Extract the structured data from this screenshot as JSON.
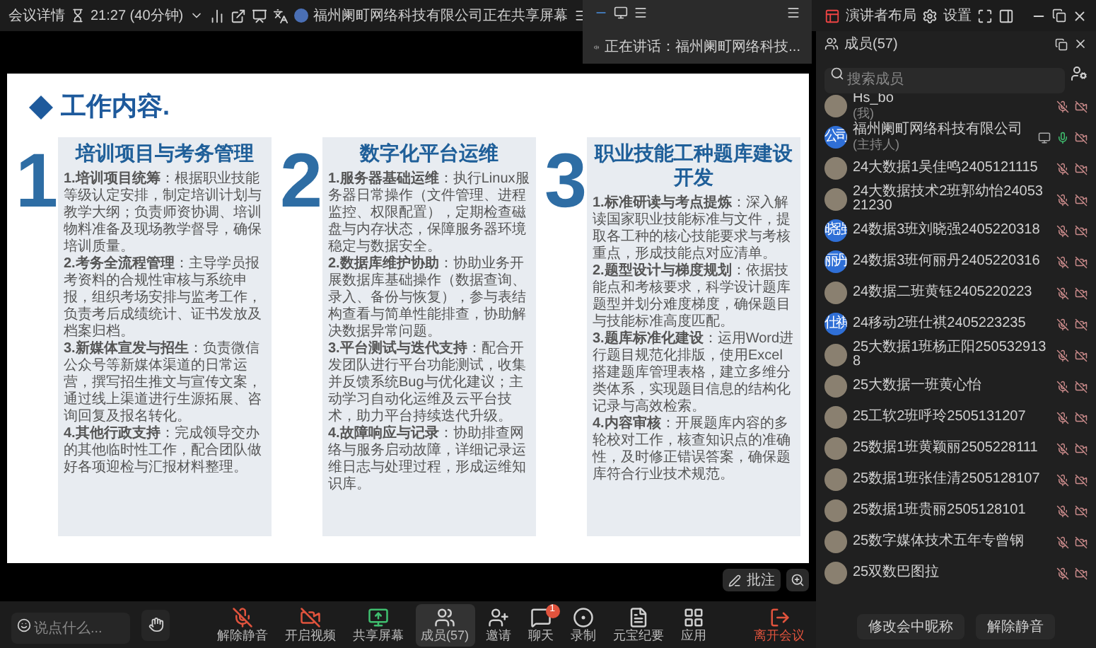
{
  "top_bar": {
    "meeting_info": "会议详情",
    "time": "21:27 (40分钟)",
    "sharing_notice": "福州阑町网络科技有限公司正在共享屏幕",
    "layout": "演讲者布局",
    "settings": "设置"
  },
  "speaker_overlay": {
    "label": "正在讲话：福州阑町网络科技..."
  },
  "slide": {
    "title": "工作内容.",
    "sections": [
      {
        "number": "1",
        "title": "培训项目与考务管理",
        "paragraphs": [
          "**1.培训项目统筹**：根据职业技能等级认定安排，制定培训计划与教学大纲；负责师资协调、培训物料准备及现场教学督导，确保培训质量。",
          "**2.考务全流程管理**：主导学员报考资料的合规性审核与系统申报，组织考场安排与监考工作，负责考后成绩统计、证书发放及档案归档。",
          "**3.新媒体宣发与招生**：负责微信公众号等新媒体渠道的日常运营，撰写招生推文与宣传文案，通过线上渠道进行生源拓展、咨询回复及报名转化。",
          "**4.其他行政支持**：完成领导交办的其他临时性工作，配合团队做好各项迎检与汇报材料整理。"
        ]
      },
      {
        "number": "2",
        "title": "数字化平台运维",
        "paragraphs": [
          "**1.服务器基础运维**：执行Linux服务器日常操作（文件管理、进程监控、权限配置），定期检查磁盘与内存状态，保障服务器环境稳定与数据安全。",
          "**2.数据库维护协助**：协助业务开展数据库基础操作（数据查询、录入、备份与恢复），参与表结构查看与简单性能排查，协助解决数据异常问题。",
          "**3.平台测试与迭代支持**：配合开发团队进行平台功能测试，收集并反馈系统Bug与优化建议；主动学习自动化运维及云平台技术，助力平台持续迭代升级。",
          "**4.故障响应与记录**：协助排查网络与服务启动故障，详细记录运维日志与处理过程，形成运维知识库。"
        ]
      },
      {
        "number": "3",
        "title": "职业技能工种题库建设开发",
        "paragraphs": [
          "**1.标准研读与考点提炼**：深入解读国家职业技能标准与文件，提取各工种的核心技能要求与考核重点，形成技能点对应清单。",
          "**2.题型设计与梯度规划**：依据技能点和考核要求，科学设计题库题型并划分难度梯度，确保题目与技能标准高度匹配。",
          "**3.题库标准化建设**：运用Word进行题目规范化排版，使用Excel搭建题库管理表格，建立多维分类体系，实现题目信息的结构化记录与高效检索。",
          "**4.内容审核**：开展题库内容的多轮校对工作，核查知识点的准确性，及时修正错误答案，确保题库符合行业技术规范。"
        ]
      }
    ]
  },
  "annotate_button": "批注",
  "toolbar": {
    "chat_input": {
      "placeholder": "说点什么..."
    },
    "buttons": [
      {
        "kind": "mic",
        "label": "解除静音",
        "selected": false
      },
      {
        "kind": "camera",
        "label": "开启视频",
        "selected": false
      },
      {
        "kind": "share",
        "label": "共享屏幕",
        "selected": false
      },
      {
        "kind": "members",
        "label": "成员(57)",
        "selected": true
      },
      {
        "kind": "invite",
        "label": "邀请",
        "selected": false
      },
      {
        "kind": "chat",
        "label": "聊天",
        "selected": false,
        "badge": "1"
      },
      {
        "kind": "record",
        "label": "录制",
        "selected": false
      },
      {
        "kind": "minutes",
        "label": "元宝纪要",
        "selected": false
      },
      {
        "kind": "apps",
        "label": "应用",
        "selected": false
      }
    ],
    "leave": "离开会议"
  },
  "members_panel": {
    "title": "成员(57)",
    "search": {
      "placeholder": "搜索成员"
    },
    "members": [
      {
        "name": "Hs_bo",
        "role": "(我)",
        "kind": "photo",
        "muted": true,
        "sharing": false
      },
      {
        "name": "福州阑町网络科技有限公司",
        "role": "(主持人)",
        "kind": "text",
        "avatar_text": "公司",
        "muted": false,
        "sharing": true
      },
      {
        "name": "24大数据1吴佳鸣2405121115",
        "kind": "photo",
        "muted": true,
        "sharing": false
      },
      {
        "name": "24大数据技术2班郭幼怡2405321230",
        "kind": "photo",
        "muted": true,
        "sharing": false
      },
      {
        "name": "24数据3班刘晓强2405220318",
        "kind": "text",
        "avatar_text": "晓强",
        "muted": true,
        "sharing": false
      },
      {
        "name": "24数据3班何丽丹2405220316",
        "kind": "text",
        "avatar_text": "丽丹",
        "muted": true,
        "sharing": false
      },
      {
        "name": "24数据二班黄钰2405220223",
        "kind": "photo",
        "muted": true,
        "sharing": false
      },
      {
        "name": "24移动2班仕祺2405223235",
        "kind": "text",
        "avatar_text": "仕祺",
        "muted": true,
        "sharing": false
      },
      {
        "name": "25大数据1班杨正阳2505329138",
        "kind": "photo",
        "muted": true,
        "sharing": false
      },
      {
        "name": "25大数据一班黄心怡",
        "kind": "photo",
        "muted": true,
        "sharing": false
      },
      {
        "name": "25工软2班呼玲2505131207",
        "kind": "photo",
        "muted": true,
        "sharing": false
      },
      {
        "name": "25数据1班黄颖丽2505228111",
        "kind": "photo",
        "muted": true,
        "sharing": false
      },
      {
        "name": "25数据1班张佳清2505128107",
        "kind": "photo",
        "muted": true,
        "sharing": false
      },
      {
        "name": "25数据1班贵丽2505128101",
        "kind": "photo",
        "muted": true,
        "sharing": false
      },
      {
        "name": "25数字媒体技术五年专曾钢",
        "kind": "photo",
        "muted": true,
        "sharing": false
      },
      {
        "name": "25双数巴图拉",
        "kind": "photo",
        "muted": true,
        "sharing": false
      }
    ],
    "buttons": [
      "修改会中昵称",
      "解除静音"
    ]
  }
}
